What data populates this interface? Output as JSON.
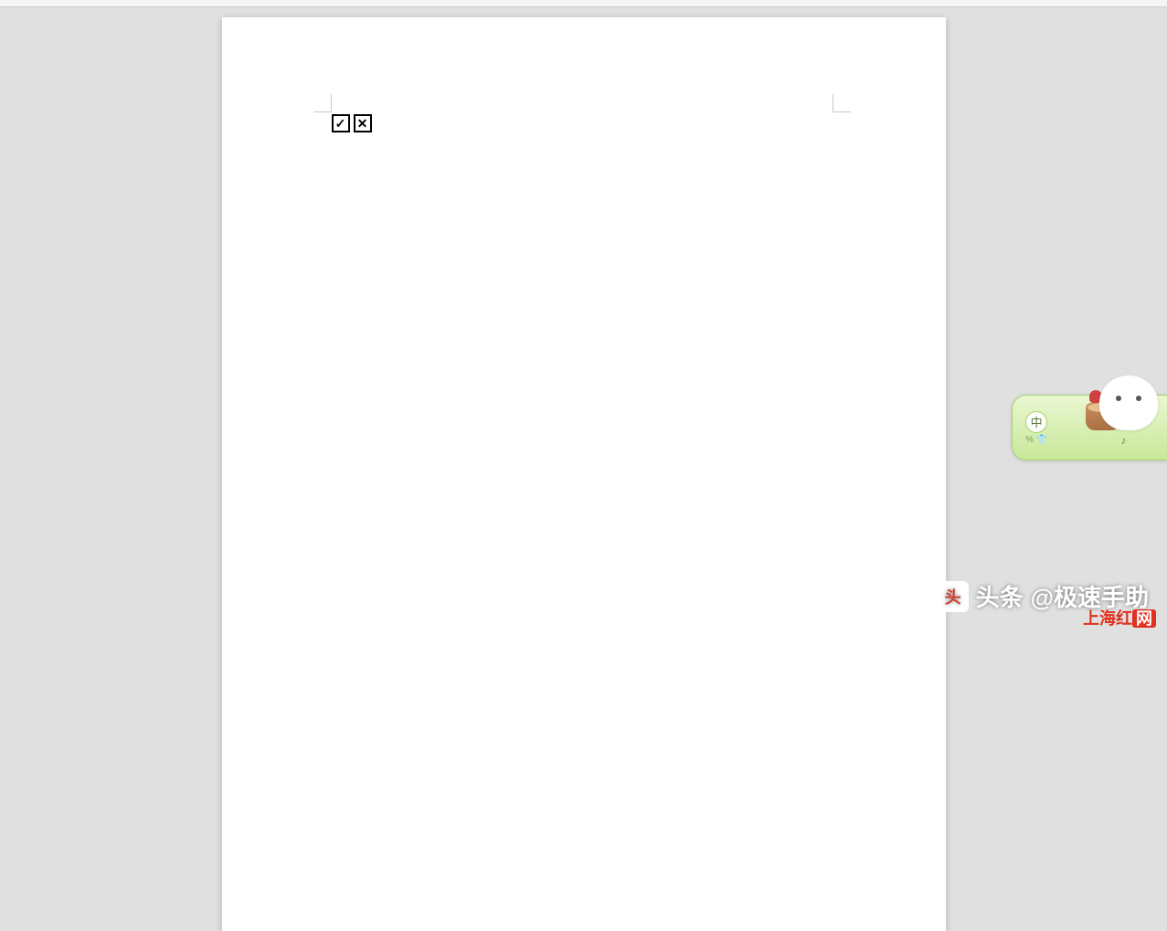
{
  "document": {
    "symbols": {
      "checked_box": "☑",
      "crossed_box": "☒"
    }
  },
  "ime": {
    "mode_label": "中",
    "sub_punct": "%",
    "sub_shirt": "👕"
  },
  "watermarks": {
    "author_prefix": "头条",
    "author_handle": "@极速手助",
    "site_red": "上海红",
    "site_box": "网"
  }
}
